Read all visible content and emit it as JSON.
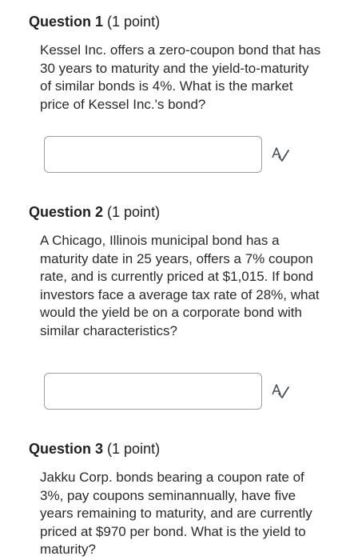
{
  "questions": [
    {
      "label": "Question 1",
      "points": "(1 point)",
      "text": "Kessel Inc. offers a zero-coupon bond that has 30 years to maturity and the yield-to-maturity of similar bonds is 4%.  What is the market price of Kessel Inc.'s bond?",
      "answer_value": ""
    },
    {
      "label": "Question 2",
      "points": "(1 point)",
      "text": "A Chicago, Illinois municipal bond has a maturity date in 25 years, offers a 7% coupon rate, and is currently priced at $1,015. If bond investors face a average tax rate of 28%, what would the yield be on a corporate bond with similar characteristics?",
      "answer_value": ""
    },
    {
      "label": "Question 3",
      "points": "(1 point)",
      "text": "Jakku Corp. bonds bearing a coupon rate of 3%, pay coupons seminannually, have five years remaining to maturity, and are currently priced at $970 per bond. What is the yield to maturity?",
      "answer_value": ""
    }
  ],
  "icons": {
    "spellcheck": "spellcheck-icon"
  },
  "colors": {
    "text": "#202122",
    "input_border": "#9a9ea3",
    "icon": "#4a4f55"
  }
}
